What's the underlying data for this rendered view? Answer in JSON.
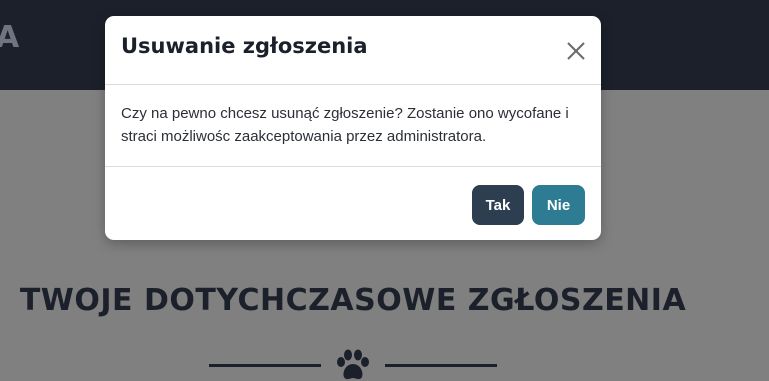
{
  "brand_fragment": "A",
  "page": {
    "section_title": "TWOJE DOTYCHCZASOWE ZGŁOSZENIA"
  },
  "icons": {
    "paw": "paw-icon",
    "close": "close-icon"
  },
  "modal": {
    "title": "Usuwanie zgłoszenia",
    "body": "Czy na pewno chcesz usunąć zgłoszenie? Zostanie ono wycofane i straci możliwośc zaakceptowania przez administratora.",
    "confirm_label": "Tak",
    "cancel_label": "Nie"
  },
  "colors": {
    "navbar": "#1b202a",
    "overlay": "#808080",
    "confirm_button": "#2c3e50",
    "cancel_button": "#2e7c94"
  }
}
